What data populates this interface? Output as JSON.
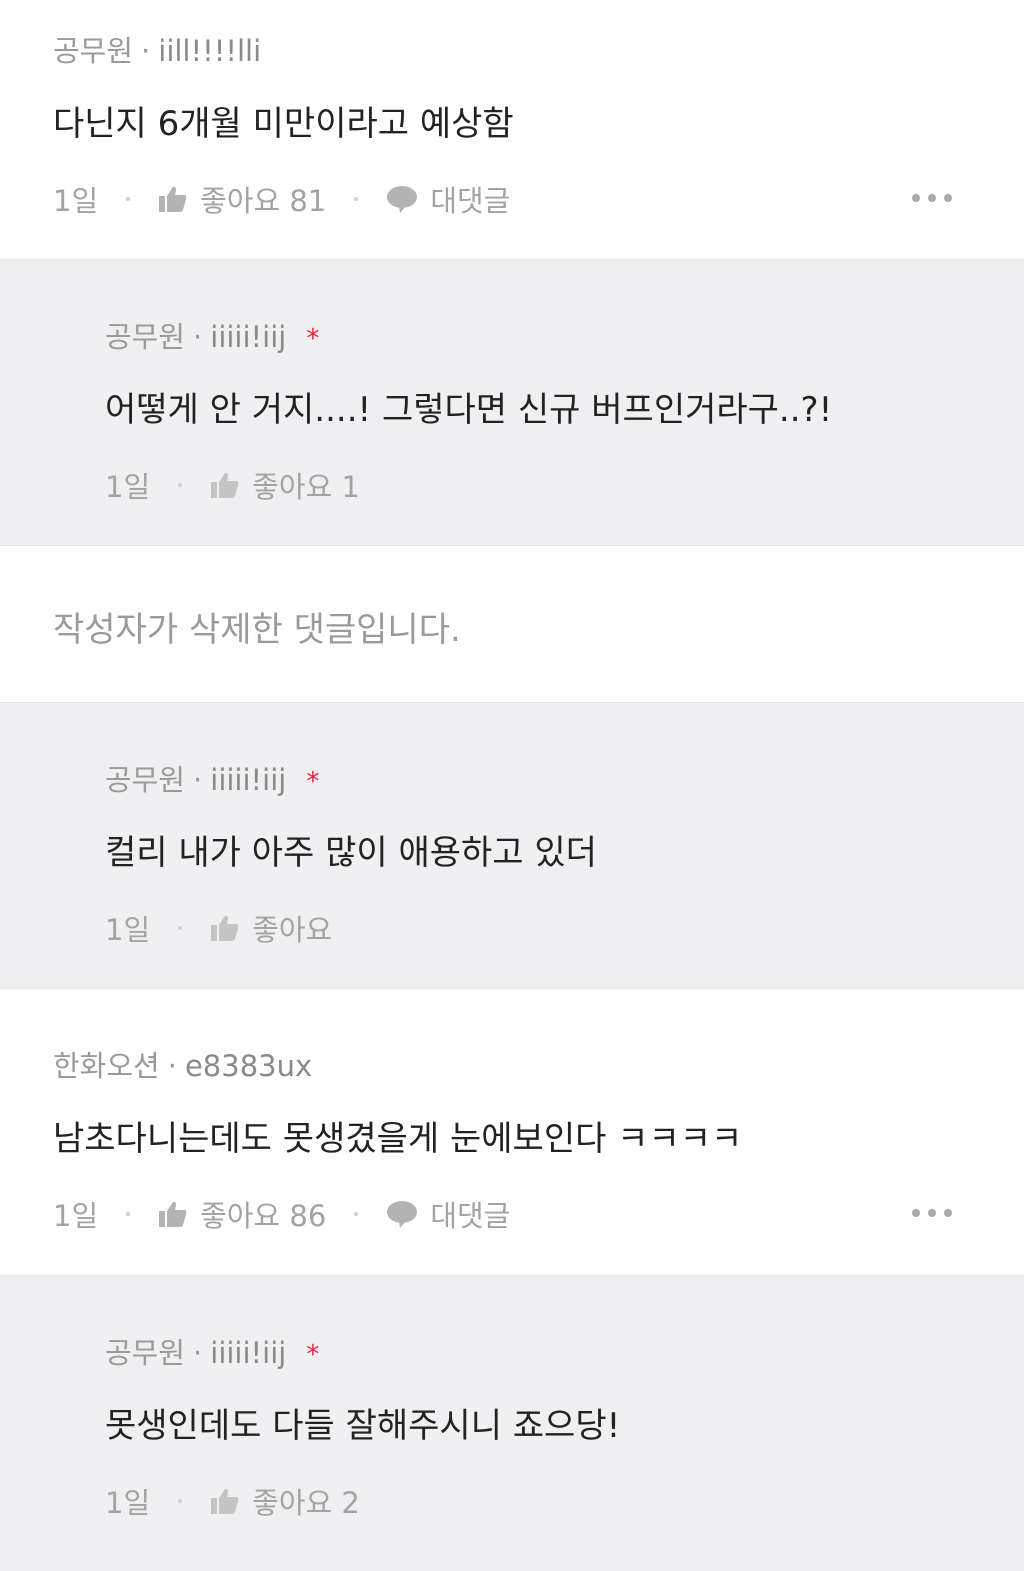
{
  "comments": [
    {
      "company": "공무원",
      "nickname": "iill!!!!lli",
      "body": "다닌지 6개월 미만이라고 예상함",
      "time": "1일",
      "like_label": "좋아요 81",
      "reply_label": "대댓글"
    },
    {
      "company": "공무원",
      "nickname": "iiiii!iij",
      "star": "*",
      "body": "어떻게 안 거지....! 그렇다면 신규 버프인거라구..?!",
      "time": "1일",
      "like_label": "좋아요 1"
    },
    {
      "deleted_text": "작성자가 삭제한 댓글입니다."
    },
    {
      "company": "공무원",
      "nickname": "iiiii!iij",
      "star": "*",
      "body": "컬리 내가 아주 많이 애용하고 있더",
      "time": "1일",
      "like_label": "좋아요"
    },
    {
      "company": "한화오션",
      "nickname": "e8383ux",
      "body": "남초다니는데도 못생겼을게 눈에보인다 ㅋㅋㅋㅋ",
      "time": "1일",
      "like_label": "좋아요 86",
      "reply_label": "대댓글"
    },
    {
      "company": "공무원",
      "nickname": "iiiii!iij",
      "star": "*",
      "body": "못생인데도 다들 잘해주시니 죠으당!",
      "time": "1일",
      "like_label": "좋아요 2"
    }
  ],
  "separator_dot": "·",
  "icons": {
    "like": "thumbs-up-icon",
    "reply": "speech-bubble-icon",
    "more": "more-dots-icon"
  },
  "colors": {
    "reply_bg": "#f0f0f2",
    "star": "#e0273a"
  }
}
